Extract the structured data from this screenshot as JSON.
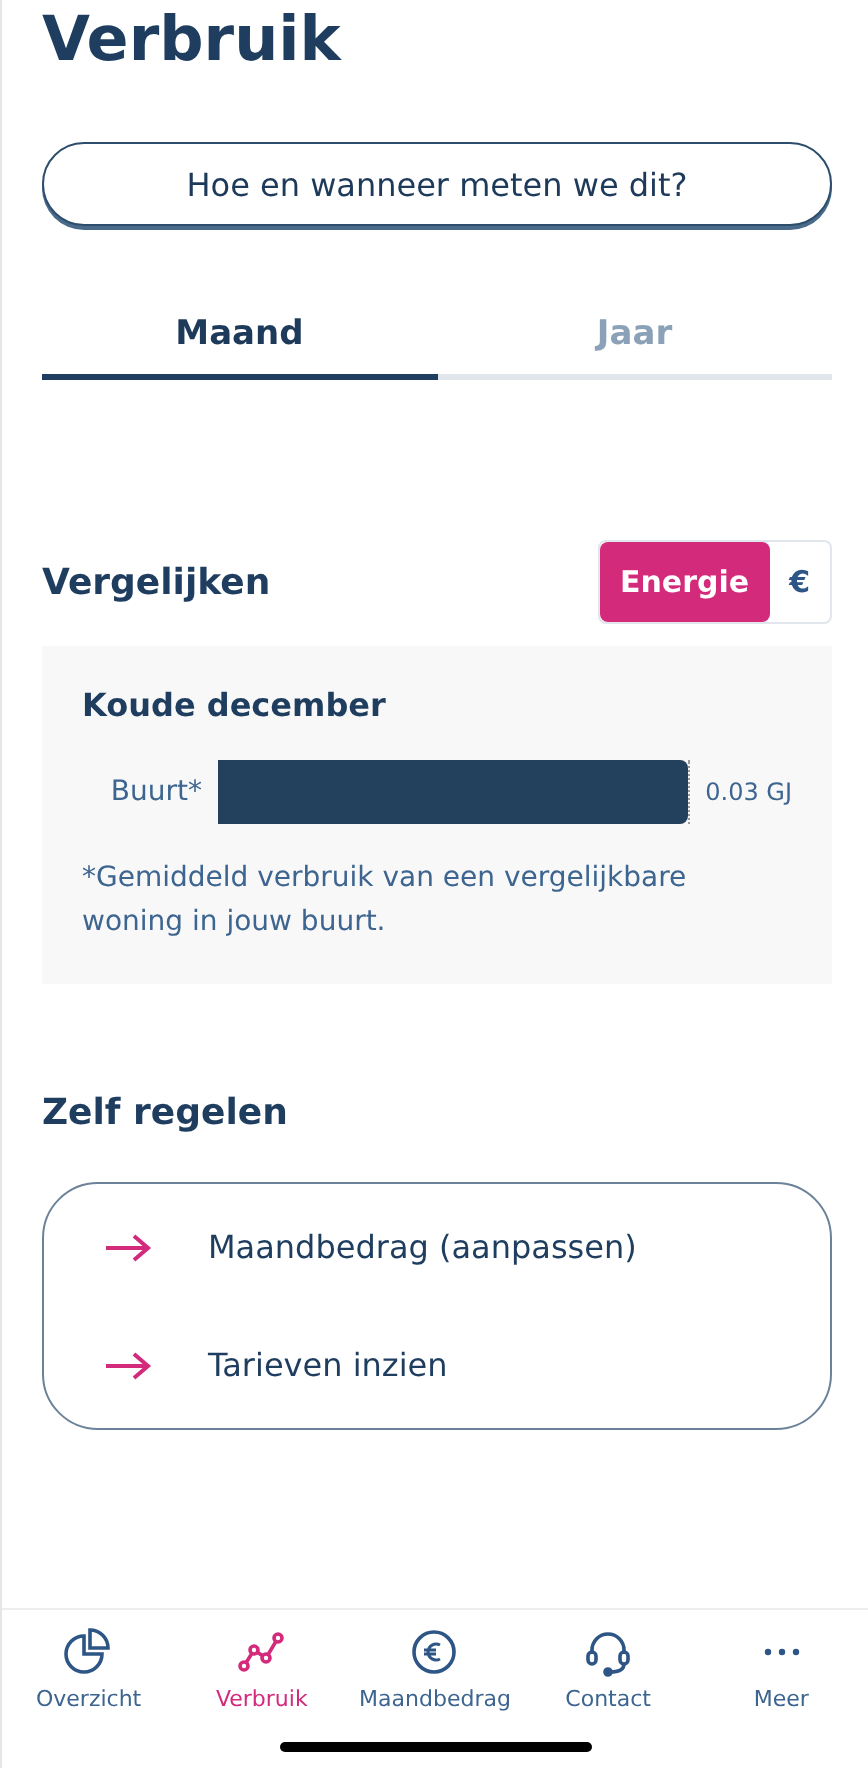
{
  "title": "Verbruik",
  "help_button": "Hoe en wanneer meten we dit?",
  "tabs": [
    {
      "label": "Maand",
      "selected": true
    },
    {
      "label": "Jaar",
      "selected": false
    }
  ],
  "compare": {
    "title": "Vergelijken",
    "toggle": [
      {
        "label": "Energie",
        "selected": true
      },
      {
        "label": "€",
        "selected": false
      }
    ],
    "card_title": "Koude december",
    "bars": [
      {
        "label": "Buurt*",
        "level": 1,
        "reading": "0.03 GJ"
      }
    ],
    "footnote": "*Gemiddeld verbruik van een vergelijkbare woning in jouw buurt."
  },
  "self_service": {
    "title": "Zelf regelen",
    "links": [
      "Maandbedrag (aanpassen)",
      "Tarieven inzien"
    ]
  },
  "nav": [
    {
      "label": "Overzicht",
      "kind": "pie",
      "selected": false
    },
    {
      "label": "Verbruik",
      "kind": "graph",
      "selected": true
    },
    {
      "label": "Maandbedrag",
      "kind": "euro",
      "selected": false
    },
    {
      "label": "Contact",
      "kind": "headset",
      "selected": false
    },
    {
      "label": "Meer",
      "kind": "dots",
      "selected": false
    }
  ]
}
